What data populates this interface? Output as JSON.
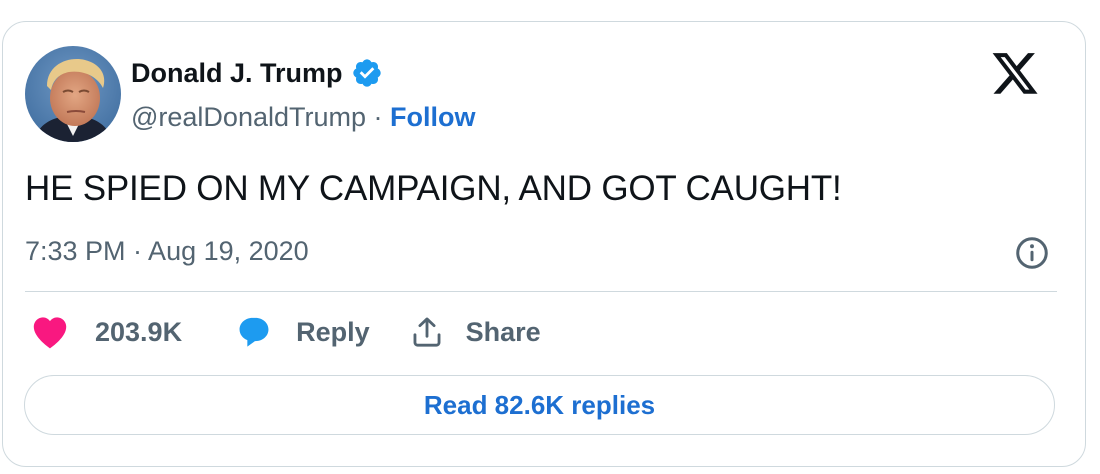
{
  "author": {
    "name": "Donald J. Trump",
    "handle": "@realDonaldTrump",
    "separator": " · ",
    "follow_label": "Follow",
    "avatar_icon": "profile-photo",
    "verified_icon": "verified-badge-icon"
  },
  "brand": {
    "logo_icon": "x-logo-icon"
  },
  "tweet": {
    "text": "HE SPIED ON MY CAMPAIGN, AND GOT CAUGHT!",
    "timestamp": "7:33 PM · Aug 19, 2020"
  },
  "actions": {
    "like_count": "203.9K",
    "reply_label": "Reply",
    "share_label": "Share"
  },
  "footer": {
    "read_replies_label": "Read 82.6K replies"
  },
  "colors": {
    "like_pink": "#f91880",
    "reply_blue": "#1d9bf0",
    "link_blue": "#1d6fd1",
    "muted_text": "#536471",
    "border": "#cfd9de"
  }
}
